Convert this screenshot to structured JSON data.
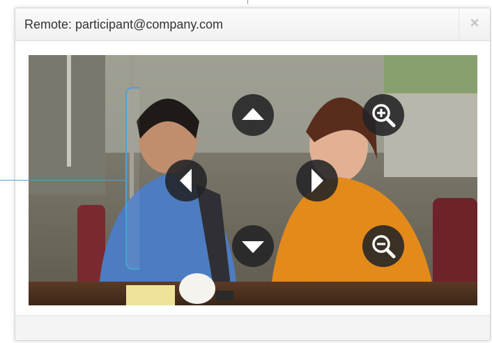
{
  "dialog": {
    "title": "Remote: participant@company.com",
    "close_label": "×"
  },
  "video": {
    "description_icons": [
      "pan-up-icon",
      "pan-down-icon",
      "pan-left-icon",
      "pan-right-icon",
      "zoom-in-icon",
      "zoom-out-icon"
    ]
  },
  "colors": {
    "accent": "#4aa3d6",
    "control_bg": "#232326",
    "header_bg": "#f0f0f0"
  }
}
